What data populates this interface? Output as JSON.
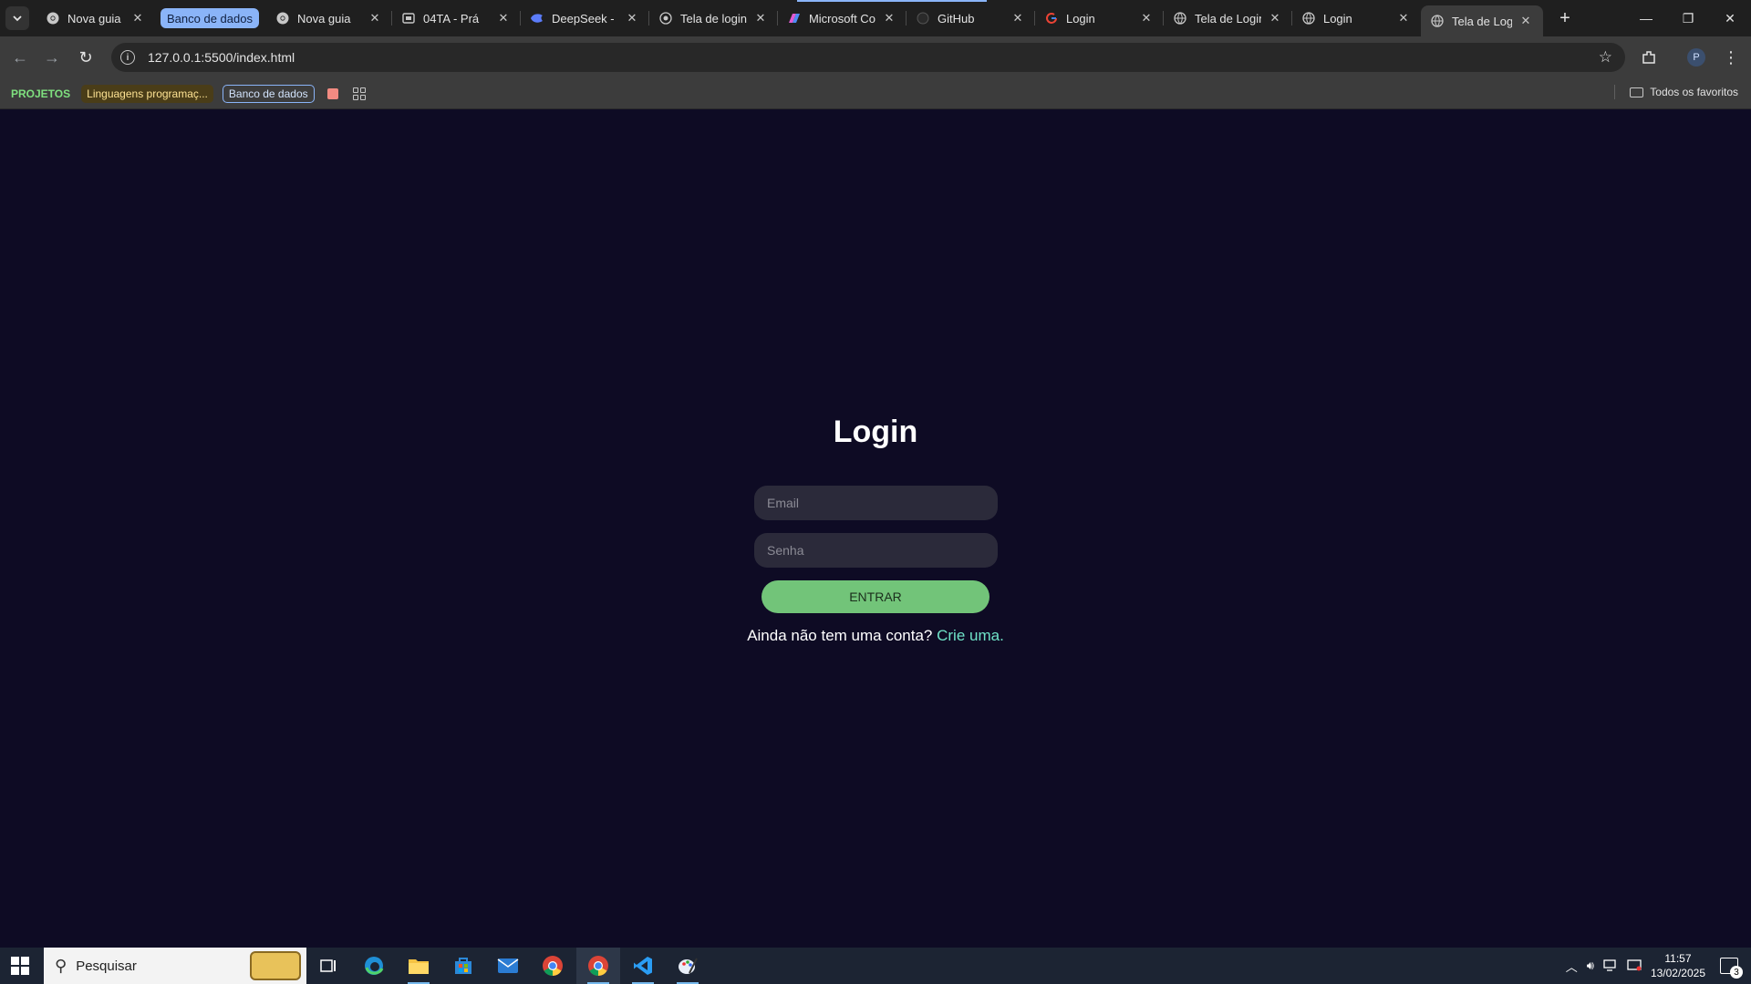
{
  "browser": {
    "tabs": [
      {
        "title": "Nova guia",
        "favicon": "chrome-icon"
      },
      {
        "title": "Nova guia",
        "favicon": "chrome-icon",
        "group": "Banco de dados"
      },
      {
        "title": "04TA - Prá",
        "favicon": "slides-icon"
      },
      {
        "title": "DeepSeek - I",
        "favicon": "deepseek-icon"
      },
      {
        "title": "Tela de login",
        "favicon": "globe-icon"
      },
      {
        "title": "Microsoft Co",
        "favicon": "copilot-icon"
      },
      {
        "title": "GitHub",
        "favicon": "github-icon"
      },
      {
        "title": "Login",
        "favicon": "google-icon"
      },
      {
        "title": "Tela de Login",
        "favicon": "globe-icon"
      },
      {
        "title": "Login",
        "favicon": "globe-icon"
      },
      {
        "title": "Tela de Login",
        "favicon": "globe-icon",
        "active": true
      }
    ],
    "tab_group_label": "Banco de dados",
    "address": "127.0.0.1:5500/index.html",
    "profile_initial": "P",
    "bookmarks": {
      "projetos": "PROJETOS",
      "linguagens": "Linguagens programaç...",
      "banco": "Banco de dados",
      "all_favorites": "Todos os favoritos"
    }
  },
  "page": {
    "title": "Login",
    "email_placeholder": "Email",
    "password_placeholder": "Senha",
    "submit_label": "ENTRAR",
    "signup_text": "Ainda não tem uma conta?",
    "signup_link": "Crie uma."
  },
  "taskbar": {
    "search_label": "Pesquisar",
    "time": "11:57",
    "date": "13/02/2025",
    "notifications": "3"
  },
  "colors": {
    "page_bg": "#0e0b24",
    "button_green": "#72c479",
    "link_color": "#6fe3c8"
  }
}
